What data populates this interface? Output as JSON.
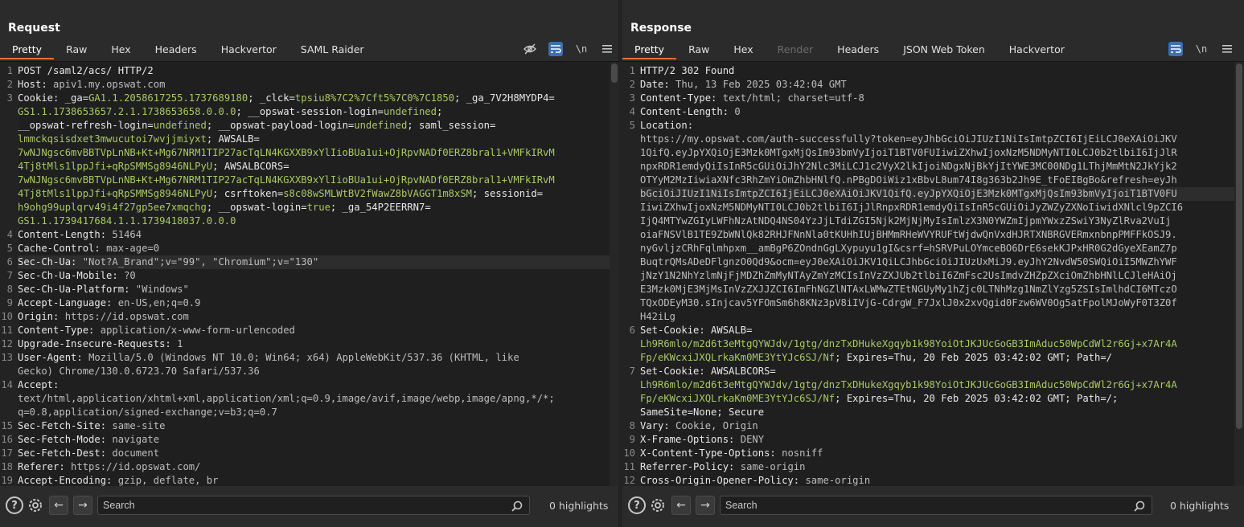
{
  "layout_modes": [
    "side-by-side",
    "top-bottom",
    "tabs"
  ],
  "request": {
    "title": "Request",
    "tabs": [
      "Pretty",
      "Raw",
      "Hex",
      "Headers",
      "Hackvertor",
      "SAML Raider"
    ],
    "active_tab": "Pretty",
    "tools": {
      "hide_icon": "eye-off-icon",
      "wrap_icon": "wrap-icon",
      "newline": "\\n",
      "menu_icon": "hamburger-icon"
    },
    "lines": [
      {
        "n": "1",
        "parts": [
          {
            "t": "POST /saml2/acs/ HTTP/2",
            "c": "hdr"
          }
        ]
      },
      {
        "n": "2",
        "parts": [
          {
            "t": "Host: ",
            "c": "hdr"
          },
          {
            "t": "apiv1.my.opswat.com",
            "c": "val"
          }
        ]
      },
      {
        "n": "3",
        "parts": [
          {
            "t": "Cookie: _ga=",
            "c": "hdr"
          },
          {
            "t": "GA1.1.2058617255.1737689180",
            "c": "ck"
          },
          {
            "t": "; _clck=",
            "c": "hdr"
          },
          {
            "t": "tpsiu8%7C2%7Cft5%7C0%7C1850",
            "c": "ck"
          },
          {
            "t": "; _ga_7V2H8MYDP4=",
            "c": "hdr"
          }
        ]
      },
      {
        "n": "",
        "parts": [
          {
            "t": "GS1.1.1738653657.2.1.1738653658.0.0.0",
            "c": "ck"
          },
          {
            "t": "; __opswat-session-login=",
            "c": "hdr"
          },
          {
            "t": "undefined",
            "c": "ck"
          },
          {
            "t": ";",
            "c": "hdr"
          }
        ]
      },
      {
        "n": "",
        "parts": [
          {
            "t": "__opswat-refresh-login=",
            "c": "hdr"
          },
          {
            "t": "undefined",
            "c": "ck"
          },
          {
            "t": "; __opswat-payload-login=",
            "c": "hdr"
          },
          {
            "t": "undefined",
            "c": "ck"
          },
          {
            "t": "; saml_session=",
            "c": "hdr"
          }
        ]
      },
      {
        "n": "",
        "parts": [
          {
            "t": "lmmckqsisdxet3mwucutoi7wvjjmiyxt",
            "c": "ck"
          },
          {
            "t": "; AWSALB=",
            "c": "hdr"
          }
        ]
      },
      {
        "n": "",
        "parts": [
          {
            "t": "7wNJNgsc6mvBBTVpLnNB+Kt+Mg67NRM1TIP27acTqLN4KGXXB9xYlIioBUa1ui+OjRpvNADf0ERZ8bral1+VMFkIRvM",
            "c": "ck"
          }
        ]
      },
      {
        "n": "",
        "parts": [
          {
            "t": "4Tj8tMls1lppJfi+qRpSMMSg8946NLPyU",
            "c": "ck"
          },
          {
            "t": "; AWSALBCORS=",
            "c": "hdr"
          }
        ]
      },
      {
        "n": "",
        "parts": [
          {
            "t": "7wNJNgsc6mvBBTVpLnNB+Kt+Mg67NRM1TIP27acTqLN4KGXXB9xYlIioBUa1ui+OjRpvNADf0ERZ8bral1+VMFkIRvM",
            "c": "ck"
          }
        ]
      },
      {
        "n": "",
        "parts": [
          {
            "t": "4Tj8tMls1lppJfi+qRpSMMSg8946NLPyU",
            "c": "ck"
          },
          {
            "t": "; csrftoken=",
            "c": "hdr"
          },
          {
            "t": "s8c08wSMLWtBV2fWawZ8bVAGGT1m8xSM",
            "c": "ck"
          },
          {
            "t": "; sessionid=",
            "c": "hdr"
          }
        ]
      },
      {
        "n": "",
        "parts": [
          {
            "t": "h9ohg99uplqrv49i4f27gp5ee7xmqchg",
            "c": "ck"
          },
          {
            "t": "; __opswat-login=",
            "c": "hdr"
          },
          {
            "t": "true",
            "c": "ck"
          },
          {
            "t": "; _ga_54P2EERRN7=",
            "c": "hdr"
          }
        ]
      },
      {
        "n": "",
        "parts": [
          {
            "t": "GS1.1.1739417684.1.1.1739418037.0.0.0",
            "c": "ck"
          }
        ]
      },
      {
        "n": "4",
        "parts": [
          {
            "t": "Content-Length: ",
            "c": "hdr"
          },
          {
            "t": "51464",
            "c": "val"
          }
        ]
      },
      {
        "n": "5",
        "parts": [
          {
            "t": "Cache-Control: ",
            "c": "hdr"
          },
          {
            "t": "max-age=0",
            "c": "val"
          }
        ]
      },
      {
        "n": "6",
        "hl": true,
        "parts": [
          {
            "t": "Sec-Ch-Ua: ",
            "c": "hdr"
          },
          {
            "t": "\"Not?A_Brand\";v=\"99\", \"Chromium\";v=\"130\"",
            "c": "val"
          }
        ]
      },
      {
        "n": "7",
        "parts": [
          {
            "t": "Sec-Ch-Ua-Mobile: ",
            "c": "hdr"
          },
          {
            "t": "?0",
            "c": "val"
          }
        ]
      },
      {
        "n": "8",
        "parts": [
          {
            "t": "Sec-Ch-Ua-Platform: ",
            "c": "hdr"
          },
          {
            "t": "\"Windows\"",
            "c": "val"
          }
        ]
      },
      {
        "n": "9",
        "parts": [
          {
            "t": "Accept-Language: ",
            "c": "hdr"
          },
          {
            "t": "en-US,en;q=0.9",
            "c": "val"
          }
        ]
      },
      {
        "n": "10",
        "parts": [
          {
            "t": "Origin: ",
            "c": "hdr"
          },
          {
            "t": "https://id.opswat.com",
            "c": "val"
          }
        ]
      },
      {
        "n": "11",
        "parts": [
          {
            "t": "Content-Type: ",
            "c": "hdr"
          },
          {
            "t": "application/x-www-form-urlencoded",
            "c": "val"
          }
        ]
      },
      {
        "n": "12",
        "parts": [
          {
            "t": "Upgrade-Insecure-Requests: ",
            "c": "hdr"
          },
          {
            "t": "1",
            "c": "val"
          }
        ]
      },
      {
        "n": "13",
        "parts": [
          {
            "t": "User-Agent: ",
            "c": "hdr"
          },
          {
            "t": "Mozilla/5.0 (Windows NT 10.0; Win64; x64) AppleWebKit/537.36 (KHTML, like",
            "c": "val"
          }
        ]
      },
      {
        "n": "",
        "parts": [
          {
            "t": "Gecko) Chrome/130.0.6723.70 Safari/537.36",
            "c": "val"
          }
        ]
      },
      {
        "n": "14",
        "parts": [
          {
            "t": "Accept:",
            "c": "hdr"
          }
        ]
      },
      {
        "n": "",
        "parts": [
          {
            "t": "text/html,application/xhtml+xml,application/xml;q=0.9,image/avif,image/webp,image/apng,*/*;",
            "c": "val"
          }
        ]
      },
      {
        "n": "",
        "parts": [
          {
            "t": "q=0.8,application/signed-exchange;v=b3;q=0.7",
            "c": "val"
          }
        ]
      },
      {
        "n": "15",
        "parts": [
          {
            "t": "Sec-Fetch-Site: ",
            "c": "hdr"
          },
          {
            "t": "same-site",
            "c": "val"
          }
        ]
      },
      {
        "n": "16",
        "parts": [
          {
            "t": "Sec-Fetch-Mode: ",
            "c": "hdr"
          },
          {
            "t": "navigate",
            "c": "val"
          }
        ]
      },
      {
        "n": "17",
        "parts": [
          {
            "t": "Sec-Fetch-Dest: ",
            "c": "hdr"
          },
          {
            "t": "document",
            "c": "val"
          }
        ]
      },
      {
        "n": "18",
        "parts": [
          {
            "t": "Referer: ",
            "c": "hdr"
          },
          {
            "t": "https://id.opswat.com/",
            "c": "val"
          }
        ]
      },
      {
        "n": "19",
        "parts": [
          {
            "t": "Accept-Encoding: ",
            "c": "hdr"
          },
          {
            "t": "gzip, deflate, br",
            "c": "val"
          }
        ]
      }
    ],
    "footer": {
      "search_placeholder": "Search",
      "highlights": "0 highlights"
    }
  },
  "response": {
    "title": "Response",
    "tabs": [
      "Pretty",
      "Raw",
      "Hex",
      "Render",
      "Headers",
      "JSON Web Token",
      "Hackvertor"
    ],
    "active_tab": "Pretty",
    "disabled_tab": "Render",
    "tools": {
      "wrap_icon": "wrap-icon",
      "newline": "\\n",
      "menu_icon": "hamburger-icon"
    },
    "lines": [
      {
        "n": "1",
        "parts": [
          {
            "t": "HTTP/2 302 Found",
            "c": "hdr"
          }
        ]
      },
      {
        "n": "2",
        "parts": [
          {
            "t": "Date: ",
            "c": "hdr"
          },
          {
            "t": "Thu, 13 Feb 2025 03:42:04 GMT",
            "c": "val"
          }
        ]
      },
      {
        "n": "3",
        "parts": [
          {
            "t": "Content-Type: ",
            "c": "hdr"
          },
          {
            "t": "text/html; charset=utf-8",
            "c": "val"
          }
        ]
      },
      {
        "n": "4",
        "parts": [
          {
            "t": "Content-Length: ",
            "c": "hdr"
          },
          {
            "t": "0",
            "c": "val"
          }
        ]
      },
      {
        "n": "5",
        "parts": [
          {
            "t": "Location:",
            "c": "hdr"
          }
        ]
      },
      {
        "n": "",
        "parts": [
          {
            "t": "https://my.opswat.com/auth-successfully?token=eyJhbGciOiJIUzI1NiIsImtpZCI6IjEiLCJ0eXAiOiJKV",
            "c": "val"
          }
        ]
      },
      {
        "n": "",
        "parts": [
          {
            "t": "1QifQ.eyJpYXQiOjE3Mzk0MTgxMjQsIm93bmVyIjoiT1BTV0FUIiwiZXhwIjoxNzM5NDMyNTI0LCJ0b2tlbiI6IjJlR",
            "c": "val"
          }
        ]
      },
      {
        "n": "",
        "parts": [
          {
            "t": "npxRDR1emdyQiIsInR5cGUiOiJhY2Nlc3MiLCJ1c2VyX2lkIjoiNDgxNjBkYjItYWE3MC00NDg1LThjMmMtN2JkYjk2",
            "c": "val"
          }
        ]
      },
      {
        "n": "",
        "parts": [
          {
            "t": "OTYyM2MzIiwiaXNfc3RhZmYiOmZhbHNlfQ.nPBgDOiWiz1xBbvL8um74I8g363b2Jh9E_tFoEIBgBo&refresh=eyJh",
            "c": "val"
          }
        ]
      },
      {
        "n": "",
        "hl": true,
        "parts": [
          {
            "t": "bGciOiJIUzI1NiIsImtpZCI6IjEiLCJ0eXAiOiJKV1QifQ.eyJpYXQiOjE3Mzk0MTgxMjQsIm93bmVyIjoiT1BTV0FU",
            "c": "val"
          }
        ]
      },
      {
        "n": "",
        "parts": [
          {
            "t": "IiwiZXhwIjoxNzM5NDMyNTI0LCJ0b2tlbiI6IjJlRnpxRDR1emdyQiIsInR5cGUiOiJyZWZyZXNoIiwidXNlcl9pZCI6",
            "c": "val"
          }
        ]
      },
      {
        "n": "",
        "parts": [
          {
            "t": "IjQ4MTYwZGIyLWFhNzAtNDQ4NS04YzJjLTdiZGI5Njk2MjNjMyIsImlzX3N0YWZmIjpmYWxzZSwiY3NyZlRva2VuIj",
            "c": "val"
          }
        ]
      },
      {
        "n": "",
        "parts": [
          {
            "t": "oiaFNSVlB1TE9ZbWNlQk82RHJFNnNla0tKUHhIUjBHMmRHeWVYRUFtWjdwQnVxdHJRTXNBRGVERmxnbnpPMFFkOSJ9.",
            "c": "val"
          }
        ]
      },
      {
        "n": "",
        "parts": [
          {
            "t": "nyGvljzCRhFqlmhpxm__amBgP6ZOndnGgLXypuyu1gI&csrf=hSRVPuLOYmceBO6DrE6sekKJPxHR0G2dGyeXEamZ7p",
            "c": "val"
          }
        ]
      },
      {
        "n": "",
        "parts": [
          {
            "t": "BuqtrQMsADeDFlgnzO0Qd9&ocm=eyJ0eXAiOiJKV1QiLCJhbGciOiJIUzUxMiJ9.eyJhY2NvdW50SWQiOiI5MWZhYWF",
            "c": "val"
          }
        ]
      },
      {
        "n": "",
        "parts": [
          {
            "t": "jNzY1N2NhYzlmNjFjMDZhZmMyNTAyZmYzMCIsInVzZXJUb2tlbiI6ZmFsc2UsImdvZHZpZXciOmZhbHNlLCJleHAiOj",
            "c": "val"
          }
        ]
      },
      {
        "n": "",
        "parts": [
          {
            "t": "E3Mzk0MjE3MjMsInVzZXJJZCI6ImFhNGZlNTAxLWMwZTEtNGUyMy1hZjc0LTNhMzg1NmZlYzg5ZSIsImlhdCI6MTczO",
            "c": "val"
          }
        ]
      },
      {
        "n": "",
        "parts": [
          {
            "t": "TQxODEyM30.sInjcav5YFOmSm6h8KNz3pV8iIVjG-CdrgW_F7JxlJ0x2xvQgid0Fzw6WV0Og5atFpolMJoWyF0T3Z0f",
            "c": "val"
          }
        ]
      },
      {
        "n": "",
        "parts": [
          {
            "t": "H42iLg",
            "c": "val"
          }
        ]
      },
      {
        "n": "6",
        "parts": [
          {
            "t": "Set-Cookie: AWSALB=",
            "c": "hdr"
          }
        ]
      },
      {
        "n": "",
        "parts": [
          {
            "t": "Lh9R6mlo/m2d6t3eMtgQYWJdv/1gtg/dnzTxDHukeXgqyb1k98YoiOtJKJUcGoGB3ImAduc50WpCdWl2r6Gj+x7Ar4A",
            "c": "ck"
          }
        ]
      },
      {
        "n": "",
        "parts": [
          {
            "t": "Fp/eKWcxiJXQLrkaKm0ME3YtYJc6SJ/Nf",
            "c": "ck"
          },
          {
            "t": "; Expires=Thu, 20 Feb 2025 03:42:02 GMT; Path=/",
            "c": "hdr"
          }
        ]
      },
      {
        "n": "7",
        "parts": [
          {
            "t": "Set-Cookie: AWSALBCORS=",
            "c": "hdr"
          }
        ]
      },
      {
        "n": "",
        "parts": [
          {
            "t": "Lh9R6mlo/m2d6t3eMtgQYWJdv/1gtg/dnzTxDHukeXgqyb1k98YoiOtJKJUcGoGB3ImAduc50WpCdWl2r6Gj+x7Ar4A",
            "c": "ck"
          }
        ]
      },
      {
        "n": "",
        "parts": [
          {
            "t": "Fp/eKWcxiJXQLrkaKm0ME3YtYJc6SJ/Nf",
            "c": "ck"
          },
          {
            "t": "; Expires=Thu, 20 Feb 2025 03:42:02 GMT; Path=/;",
            "c": "hdr"
          }
        ]
      },
      {
        "n": "",
        "parts": [
          {
            "t": "SameSite=None; Secure",
            "c": "hdr"
          }
        ]
      },
      {
        "n": "8",
        "parts": [
          {
            "t": "Vary: ",
            "c": "hdr"
          },
          {
            "t": "Cookie, Origin",
            "c": "val"
          }
        ]
      },
      {
        "n": "9",
        "parts": [
          {
            "t": "X-Frame-Options: ",
            "c": "hdr"
          },
          {
            "t": "DENY",
            "c": "val"
          }
        ]
      },
      {
        "n": "10",
        "parts": [
          {
            "t": "X-Content-Type-Options: ",
            "c": "hdr"
          },
          {
            "t": "nosniff",
            "c": "val"
          }
        ]
      },
      {
        "n": "11",
        "parts": [
          {
            "t": "Referrer-Policy: ",
            "c": "hdr"
          },
          {
            "t": "same-origin",
            "c": "val"
          }
        ]
      },
      {
        "n": "12",
        "parts": [
          {
            "t": "Cross-Origin-Opener-Policy: ",
            "c": "hdr"
          },
          {
            "t": "same-origin",
            "c": "val"
          }
        ]
      }
    ],
    "footer": {
      "search_placeholder": "Search",
      "highlights": "0 highlights"
    }
  },
  "colors": {
    "accent_tab_underline": "#e8703a",
    "active_tool": "#3d6fb0",
    "cookie_value": "#a8c964"
  }
}
